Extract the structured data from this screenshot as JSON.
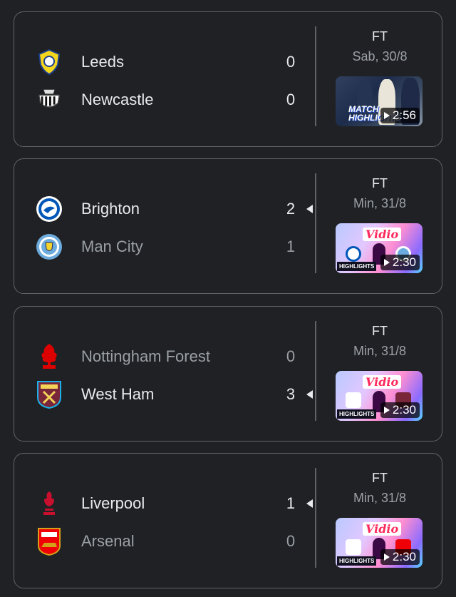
{
  "matches": [
    {
      "home": {
        "name": "Leeds",
        "score": "0",
        "crest": "leeds-crest-icon"
      },
      "away": {
        "name": "Newcastle",
        "score": "0",
        "crest": "newcastle-crest-icon"
      },
      "status": "FT",
      "date": "Sab, 30/8",
      "winner": "none",
      "video": {
        "duration": "2:56",
        "label": "MATCH HIGHLIGHTS"
      }
    },
    {
      "home": {
        "name": "Brighton",
        "score": "2",
        "crest": "brighton-crest-icon"
      },
      "away": {
        "name": "Man City",
        "score": "1",
        "crest": "man-city-crest-icon"
      },
      "status": "FT",
      "date": "Min, 31/8",
      "winner": "home",
      "video": {
        "duration": "2:30",
        "brand": "Vidio",
        "label": "HIGHLIGHTS"
      }
    },
    {
      "home": {
        "name": "Nottingham Forest",
        "score": "0",
        "crest": "nottingham-forest-crest-icon"
      },
      "away": {
        "name": "West Ham",
        "score": "3",
        "crest": "west-ham-crest-icon"
      },
      "status": "FT",
      "date": "Min, 31/8",
      "winner": "away",
      "video": {
        "duration": "2:30",
        "brand": "Vidio",
        "label": "HIGHLIGHTS"
      }
    },
    {
      "home": {
        "name": "Liverpool",
        "score": "1",
        "crest": "liverpool-crest-icon"
      },
      "away": {
        "name": "Arsenal",
        "score": "0",
        "crest": "arsenal-crest-icon"
      },
      "status": "FT",
      "date": "Min, 31/8",
      "winner": "home",
      "video": {
        "duration": "2:30",
        "brand": "Vidio",
        "label": "HIGHLIGHTS"
      }
    }
  ],
  "colors": {
    "background": "#202124",
    "border": "#5f6368",
    "text": "#e8eaed",
    "muted": "#9aa0a6",
    "vidio_red": "#ff2a5c"
  }
}
